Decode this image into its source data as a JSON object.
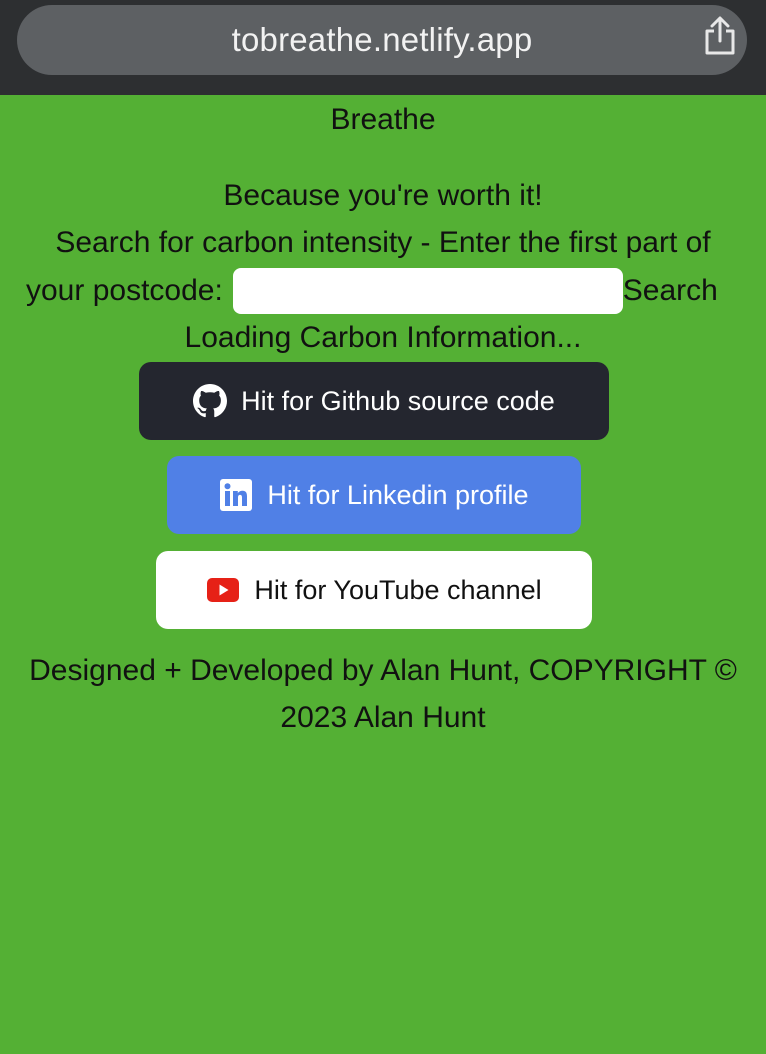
{
  "browser": {
    "url": "tobreathe.netlify.app",
    "share_icon": "share-icon"
  },
  "page": {
    "title": "Breathe",
    "tagline": "Because you're worth it!",
    "search_prompt_line1": "Search for carbon intensity - Enter the first part of",
    "search_prompt_line2": "your postcode:",
    "postcode_value": "",
    "search_label": "Search",
    "loading_text": "Loading Carbon Information..."
  },
  "buttons": {
    "github": {
      "label": "Hit for Github source code",
      "icon": "github-icon"
    },
    "linkedin": {
      "label": "Hit for Linkedin profile",
      "icon": "linkedin-icon"
    },
    "youtube": {
      "label": "Hit for YouTube channel",
      "icon": "youtube-icon"
    }
  },
  "footer": {
    "line1": "Designed + Developed by Alan Hunt, COPYRIGHT ©",
    "line2": "2023 Alan Hunt"
  },
  "colors": {
    "background": "#54b034",
    "github_button": "#24262f",
    "linkedin_button": "#5080e6",
    "youtube_button": "#ffffff",
    "youtube_red": "#e62117"
  }
}
